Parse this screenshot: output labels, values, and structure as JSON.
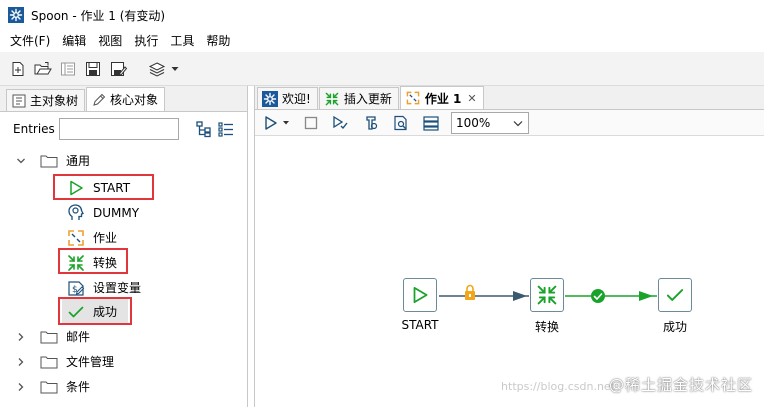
{
  "window": {
    "title": "Spoon - 作业 1 (有变动)"
  },
  "menu": [
    "文件(F)",
    "编辑",
    "视图",
    "执行",
    "工具",
    "帮助"
  ],
  "left_panel": {
    "tabs": [
      {
        "label": "主对象树",
        "icon": "tree-icon",
        "active": false
      },
      {
        "label": "核心对象",
        "icon": "pencil-icon",
        "active": true
      }
    ],
    "entries_label": "Entries",
    "entries_value": "",
    "tree": {
      "folders": [
        {
          "label": "通用",
          "expanded": true
        },
        {
          "label": "邮件",
          "expanded": false
        },
        {
          "label": "文件管理",
          "expanded": false
        },
        {
          "label": "条件",
          "expanded": false
        }
      ],
      "general_items": [
        {
          "label": "START",
          "icon": "start-icon",
          "highlighted": true
        },
        {
          "label": "DUMMY",
          "icon": "dummy-icon",
          "highlighted": false
        },
        {
          "label": "作业",
          "icon": "job-icon",
          "highlighted": false
        },
        {
          "label": "转换",
          "icon": "transformation-icon",
          "highlighted": true
        },
        {
          "label": "设置变量",
          "icon": "set-variables-icon",
          "highlighted": false
        },
        {
          "label": "成功",
          "icon": "success-icon",
          "highlighted": true,
          "selected": true
        }
      ]
    }
  },
  "right_panel": {
    "tabs": [
      {
        "label": "欢迎!",
        "icon": "spoon-icon",
        "active": false
      },
      {
        "label": "插入更新",
        "icon": "transformation-icon",
        "active": false
      },
      {
        "label": "作业 1",
        "icon": "job-icon",
        "active": true,
        "closable": true
      }
    ],
    "zoom": "100%",
    "canvas": {
      "nodes": [
        {
          "label": "START",
          "icon": "start-icon"
        },
        {
          "label": "转换",
          "icon": "transformation-icon"
        },
        {
          "label": "成功",
          "icon": "success-icon"
        }
      ],
      "hops": [
        {
          "from": "START",
          "to": "转换",
          "badge": "lock-icon",
          "color": "#3c5a6e"
        },
        {
          "from": "转换",
          "to": "成功",
          "badge": "check-circle-icon",
          "color": "#1aa32a"
        }
      ]
    }
  },
  "watermark": {
    "url": "https://blog.csdn.net",
    "text": "@稀土掘金技术社区"
  },
  "colors": {
    "accent_red": "#e0363c",
    "success_green": "#1aa32a",
    "hop_blue": "#3c5a6e",
    "job_orange": "#f0a030"
  }
}
